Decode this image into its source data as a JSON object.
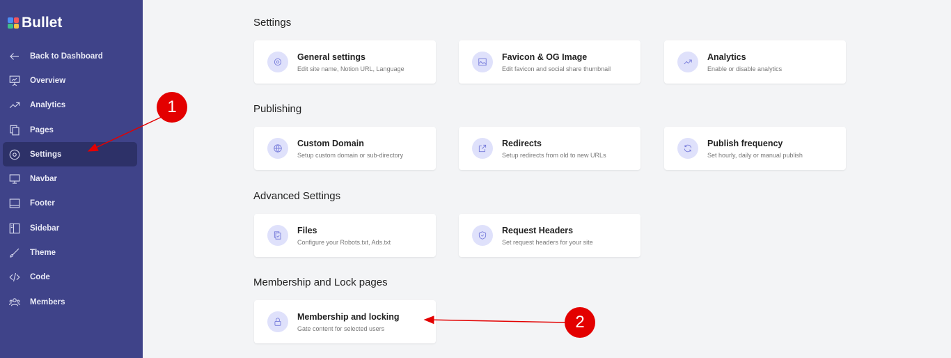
{
  "app": {
    "name": "Bullet"
  },
  "sidebar": {
    "items": [
      {
        "label": "Back to Dashboard",
        "icon": "arrow-left-icon"
      },
      {
        "label": "Overview",
        "icon": "presentation-icon"
      },
      {
        "label": "Analytics",
        "icon": "trend-icon"
      },
      {
        "label": "Pages",
        "icon": "pages-icon"
      },
      {
        "label": "Settings",
        "icon": "settings-icon",
        "active": true
      },
      {
        "label": "Navbar",
        "icon": "monitor-icon"
      },
      {
        "label": "Footer",
        "icon": "footer-icon"
      },
      {
        "label": "Sidebar",
        "icon": "sidebar-icon"
      },
      {
        "label": "Theme",
        "icon": "brush-icon"
      },
      {
        "label": "Code",
        "icon": "code-icon"
      },
      {
        "label": "Members",
        "icon": "members-icon"
      }
    ]
  },
  "sections": [
    {
      "title": "Settings",
      "cards": [
        {
          "title": "General settings",
          "desc": "Edit site name, Notion URL, Language",
          "icon": "gear-icon"
        },
        {
          "title": "Favicon & OG Image",
          "desc": "Edit favicon and social share thumbnail",
          "icon": "image-icon"
        },
        {
          "title": "Analytics",
          "desc": "Enable or disable analytics",
          "icon": "trend-icon"
        }
      ]
    },
    {
      "title": "Publishing",
      "cards": [
        {
          "title": "Custom Domain",
          "desc": "Setup custom domain or sub-directory",
          "icon": "globe-icon"
        },
        {
          "title": "Redirects",
          "desc": "Setup redirects from old to new URLs",
          "icon": "external-link-icon"
        },
        {
          "title": "Publish frequency",
          "desc": "Set hourly, daily or manual publish",
          "icon": "refresh-icon"
        }
      ]
    },
    {
      "title": "Advanced Settings",
      "cards": [
        {
          "title": "Files",
          "desc": "Configure your Robots.txt, Ads.txt",
          "icon": "files-icon"
        },
        {
          "title": "Request Headers",
          "desc": "Set request headers for your site",
          "icon": "shield-icon"
        }
      ]
    },
    {
      "title": "Membership and Lock pages",
      "cards": [
        {
          "title": "Membership and locking",
          "desc": "Gate content for selected users",
          "icon": "lock-icon"
        }
      ]
    }
  ],
  "annotations": [
    "1",
    "2"
  ],
  "colors": {
    "sidebar": "#3f4389",
    "active": "#2d3168",
    "accent": "#7378d9",
    "annotation": "#e30000"
  }
}
